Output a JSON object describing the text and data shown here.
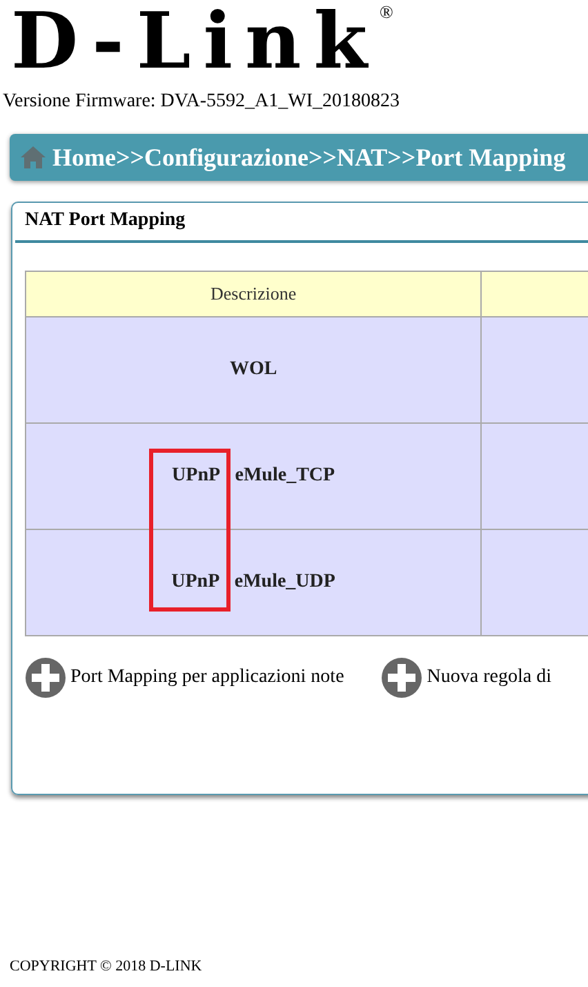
{
  "logo": {
    "text": "D-Link",
    "registered": "®"
  },
  "firmware": "Versione Firmware: DVA-5592_A1_WI_20180823",
  "breadcrumb": "Home>>Configurazione>>NAT>>Port Mapping",
  "panel": {
    "title": "NAT Port Mapping",
    "table": {
      "columns": [
        "Descrizione",
        ""
      ],
      "rows": [
        {
          "cells": [
            "WOL",
            ""
          ]
        },
        {
          "cells": [
            "UPnP eMule_TCP",
            ""
          ]
        },
        {
          "cells": [
            "UPnP eMule_UDP",
            ""
          ]
        }
      ]
    },
    "actions": [
      "Port Mapping per applicazioni note",
      "Nuova regola di"
    ]
  },
  "footer": "COPYRIGHT © 2018 D-LINK"
}
